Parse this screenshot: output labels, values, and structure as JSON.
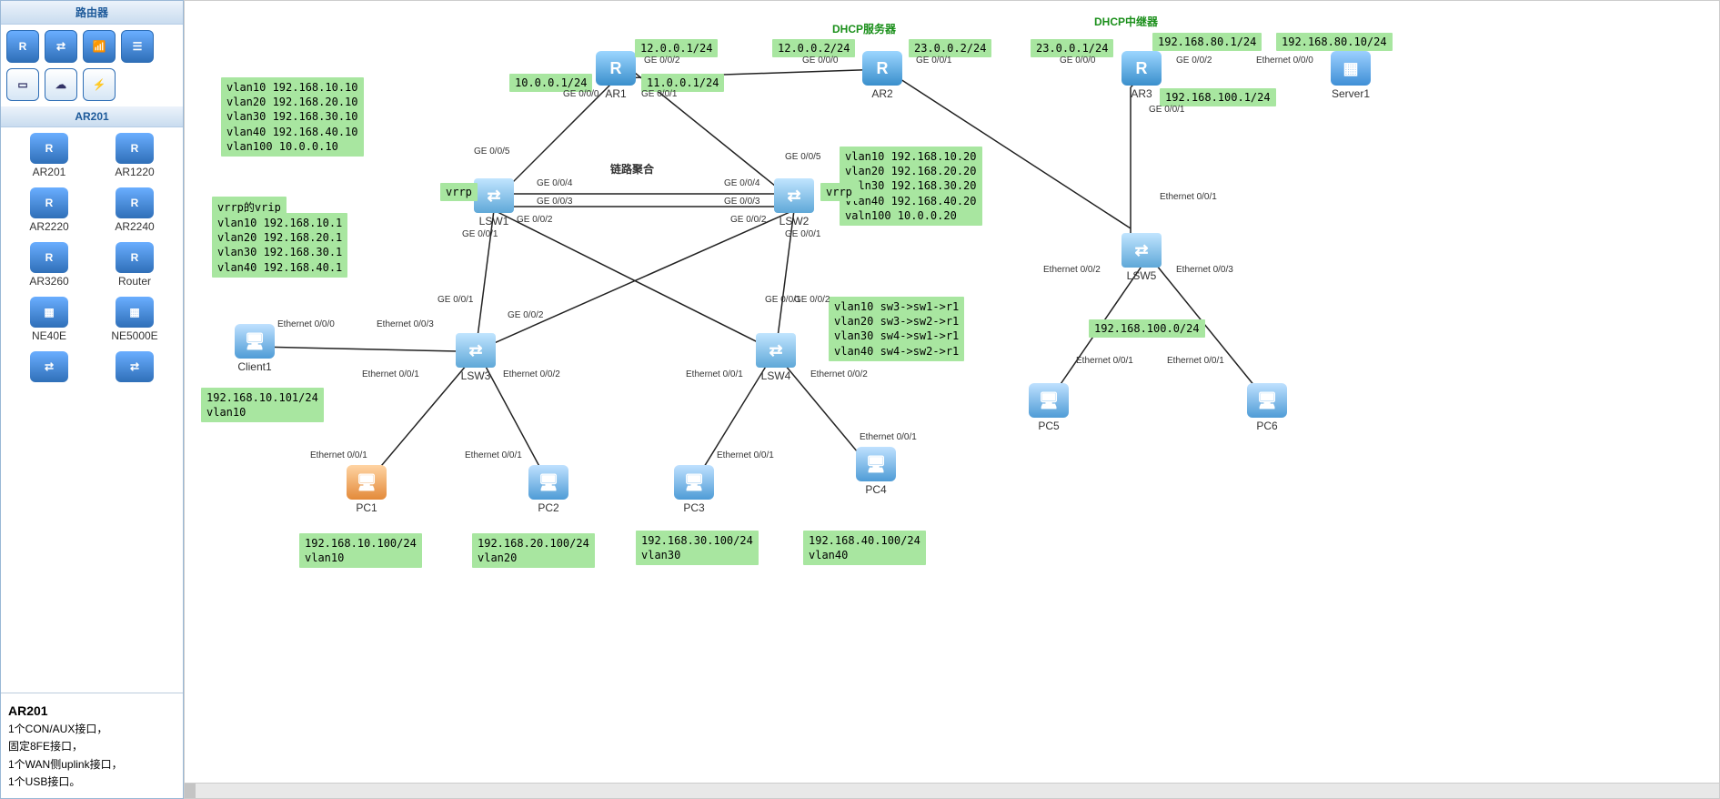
{
  "sidebar": {
    "header1": "路由器",
    "toolIcons": [
      "R",
      "⇄",
      "📶",
      "☰",
      "▭",
      "☁",
      "⚡"
    ],
    "header2": "AR201",
    "devices": [
      {
        "label": "AR201",
        "glyph": "R"
      },
      {
        "label": "AR1220",
        "glyph": "R"
      },
      {
        "label": "AR2220",
        "glyph": "R"
      },
      {
        "label": "AR2240",
        "glyph": "R"
      },
      {
        "label": "AR3260",
        "glyph": "R"
      },
      {
        "label": "Router",
        "glyph": "R"
      },
      {
        "label": "NE40E",
        "glyph": "▦"
      },
      {
        "label": "NE5000E",
        "glyph": "▦"
      }
    ],
    "info_title": "AR201",
    "info_lines": "1个CON/AUX接口，\n固定8FE接口，\n1个WAN侧uplink接口，\n1个USB接口。"
  },
  "nodes": {
    "ar1": {
      "label": "AR1"
    },
    "ar2": {
      "label": "AR2"
    },
    "ar3": {
      "label": "AR3"
    },
    "lsw1": {
      "label": "LSW1"
    },
    "lsw2": {
      "label": "LSW2"
    },
    "lsw3": {
      "label": "LSW3"
    },
    "lsw4": {
      "label": "LSW4"
    },
    "lsw5": {
      "label": "LSW5"
    },
    "client1": {
      "label": "Client1"
    },
    "server1": {
      "label": "Server1"
    },
    "pc1": {
      "label": "PC1"
    },
    "pc2": {
      "label": "PC2"
    },
    "pc3": {
      "label": "PC3"
    },
    "pc4": {
      "label": "PC4"
    },
    "pc5": {
      "label": "PC5"
    },
    "pc6": {
      "label": "PC6"
    }
  },
  "tags": {
    "lsw1_vlans": "vlan10 192.168.10.10\nvlan20 192.168.20.10\nvlan30 192.168.30.10\nvlan40 192.168.40.10\nvlan100 10.0.0.10",
    "vrrp_title": "vrrp的vrip",
    "vrrp_vlans": "vlan10 192.168.10.1\nvlan20 192.168.20.1\nvlan30 192.168.30.1\nvlan40 192.168.40.1",
    "lsw2_vlans": "vlan10 192.168.10.20\nvlan20 192.168.20.20\nvaln30 192.168.30.20\nvlan40 192.168.40.20\nvaln100 10.0.0.20",
    "path_vlans": "vlan10 sw3->sw1->r1\nvlan20 sw3->sw2->r1\nvlan30 sw4->sw1->r1\nvlan40 sw4->sw2->r1",
    "ar1_g000": "10.0.0.1/24",
    "ar1_g002": "12.0.0.1/24",
    "ar1_g001": "11.0.0.1/24",
    "ar2_g000": "12.0.0.2/24",
    "ar2_g001": "23.0.0.2/24",
    "ar3_g000": "23.0.0.1/24",
    "ar3_g002": "192.168.80.1/24",
    "ar3_g001": "192.168.100.1/24",
    "server1": "192.168.80.10/24",
    "lsw5_net": "192.168.100.0/24",
    "client1": "192.168.10.101/24\nvlan10",
    "pc1": "192.168.10.100/24\nvlan10",
    "pc2": "192.168.20.100/24\nvlan20",
    "pc3": "192.168.30.100/24\nvlan30",
    "pc4": "192.168.40.100/24\nvlan40",
    "vrrp_l": "vrrp",
    "vrrp_r": "vrrp",
    "link_agg": "链路聚合",
    "dhcp_server": "DHCP服务器",
    "dhcp_relay": "DHCP中继器"
  },
  "ports": {
    "ar1_g000": "GE 0/0/0",
    "ar1_g001": "GE 0/0/1",
    "ar1_g002": "GE 0/0/2",
    "ar2_g000": "GE 0/0/0",
    "ar2_g001": "GE 0/0/1",
    "ar3_g000": "GE 0/0/0",
    "ar3_g001": "GE 0/0/1",
    "ar3_g002": "GE 0/0/2",
    "lsw1_g005": "GE 0/0/5",
    "lsw1_g004": "GE 0/0/4",
    "lsw1_g003": "GE 0/0/3",
    "lsw1_g001": "GE 0/0/1",
    "lsw1_g002": "GE 0/0/2",
    "lsw2_g005": "GE 0/0/5",
    "lsw2_g004": "GE 0/0/4",
    "lsw2_g003": "GE 0/0/3",
    "lsw2_g001": "GE 0/0/1",
    "lsw2_g002": "GE 0/0/2",
    "lsw3_g001": "GE 0/0/1",
    "lsw3_g002": "GE 0/0/2",
    "lsw3_e001": "Ethernet 0/0/1",
    "lsw3_e002": "Ethernet 0/0/2",
    "lsw3_e003": "Ethernet 0/0/3",
    "lsw4_g001": "GE 0/0/1",
    "lsw4_g002": "GE 0/0/2",
    "lsw4_e001": "Ethernet 0/0/1",
    "lsw4_e002": "Ethernet 0/0/2",
    "lsw5_e001t": "Ethernet 0/0/1",
    "lsw5_e002": "Ethernet 0/0/2",
    "lsw5_e003": "Ethernet 0/0/3",
    "client1_e000": "Ethernet 0/0/0",
    "server1_e000": "Ethernet 0/0/0",
    "pc_e001": "Ethernet 0/0/1"
  }
}
